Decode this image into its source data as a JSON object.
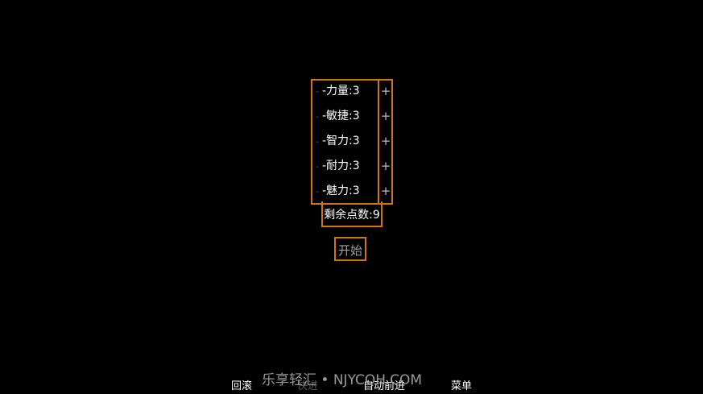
{
  "stats": [
    {
      "minus": "-",
      "label": "-力量:3",
      "plus": "+"
    },
    {
      "minus": "-",
      "label": "-敏捷:3",
      "plus": "+"
    },
    {
      "minus": "-",
      "label": "-智力:3",
      "plus": "+"
    },
    {
      "minus": "-",
      "label": "-耐力:3",
      "plus": "+"
    },
    {
      "minus": "-",
      "label": "-魅力:3",
      "plus": "+"
    }
  ],
  "remaining": "剩余点数:9",
  "start_label": "开始",
  "bottom": {
    "back": "回滚",
    "fast": "快进",
    "auto": "自动前进",
    "menu": "菜单"
  },
  "watermark": "乐享轻汇 • NJYCQH.COM",
  "colors": {
    "accent": "#d0731c",
    "background": "#000000",
    "disabled_text": "#5a5a5a"
  }
}
